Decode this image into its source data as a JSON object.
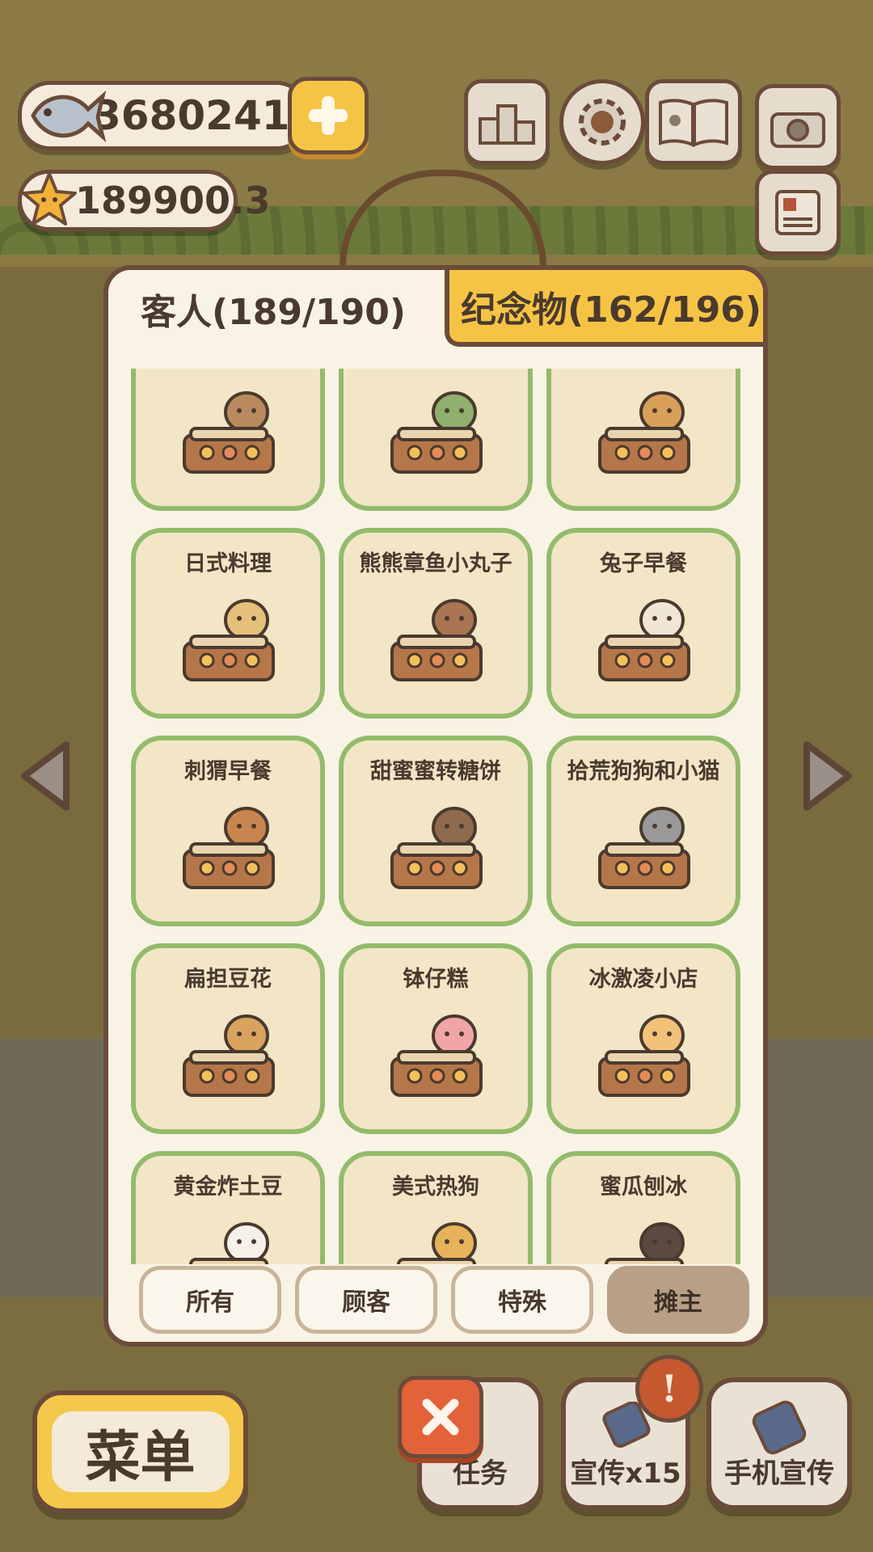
{
  "currency": {
    "fish": "36802411",
    "stars": "189900.3"
  },
  "top_buttons": [
    "ranking-icon",
    "gear-icon",
    "album-icon",
    "camera-icon",
    "newspaper-icon"
  ],
  "panel": {
    "tabs": [
      {
        "label": "客人(189/190)",
        "active": true
      },
      {
        "label": "纪念物(162/196)",
        "active": false
      }
    ],
    "cards": [
      {
        "name": ""
      },
      {
        "name": ""
      },
      {
        "name": ""
      },
      {
        "name": "日式料理"
      },
      {
        "name": "熊熊章鱼小丸子"
      },
      {
        "name": "兔子早餐"
      },
      {
        "name": "刺猬早餐"
      },
      {
        "name": "甜蜜蜜转糖饼"
      },
      {
        "name": "拾荒狗狗和小猫"
      },
      {
        "name": "扁担豆花"
      },
      {
        "name": "钵仔糕"
      },
      {
        "name": "冰激凌小店"
      },
      {
        "name": "黄金炸土豆"
      },
      {
        "name": "美式热狗"
      },
      {
        "name": "蜜瓜刨冰"
      }
    ],
    "filters": [
      {
        "label": "所有",
        "active": false
      },
      {
        "label": "顾客",
        "active": false
      },
      {
        "label": "特殊",
        "active": false
      },
      {
        "label": "摊主",
        "active": true
      }
    ]
  },
  "bottom": {
    "menu_label": "菜单",
    "tasks_label": "任务",
    "promo_label": "宣传x15",
    "phone_promo_label": "手机宣传",
    "alert_badge": "!"
  },
  "colors": {
    "accent_yellow": "#f6c445",
    "card_border": "#93bb6b",
    "card_bg": "#f2e6c6",
    "outline": "#6b4b3a"
  }
}
